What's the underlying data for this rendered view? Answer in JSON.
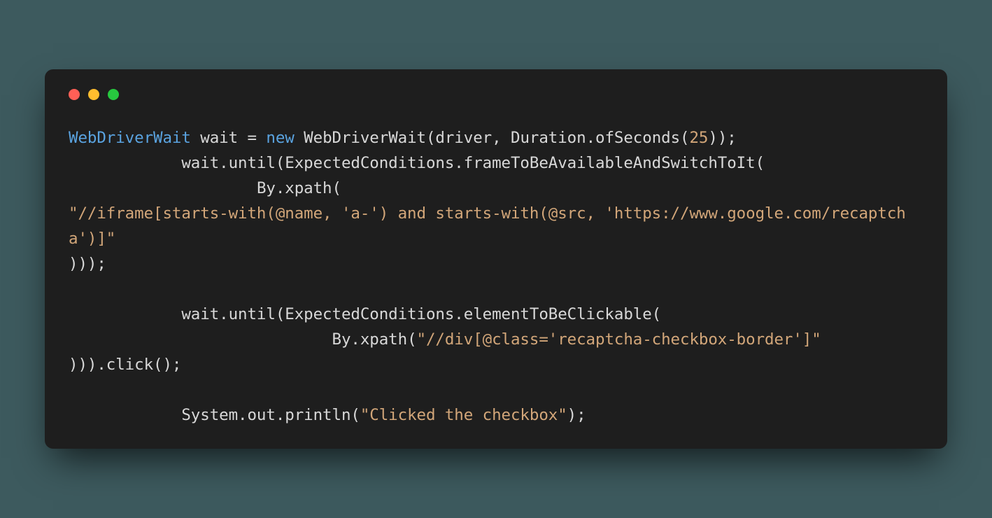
{
  "code": {
    "line1": {
      "type": "WebDriverWait",
      "text1": " wait = ",
      "keyword": "new",
      "text2": " WebDriverWait(driver, Duration.ofSeconds(",
      "number": "25",
      "text3": "));"
    },
    "line2": "            wait.until(ExpectedConditions.frameToBeAvailableAndSwitchToIt(",
    "line3": "                    By.xpath(",
    "line4a": "\"//iframe[starts-with(@name, 'a-') and starts-with(@src, 'https://www.google.com/recaptcha')]\"",
    "line5": ")));",
    "line6": "",
    "line7": "            wait.until(ExpectedConditions.elementToBeClickable(",
    "line8": {
      "text1": "                            By.xpath(",
      "string": "\"//div[@class='recaptcha-checkbox-border']\"",
      "text2": ""
    },
    "line9": "))).click();",
    "line10": "",
    "line11": {
      "text1": "            System.out.println(",
      "string": "\"Clicked the checkbox\"",
      "text2": ");"
    }
  }
}
